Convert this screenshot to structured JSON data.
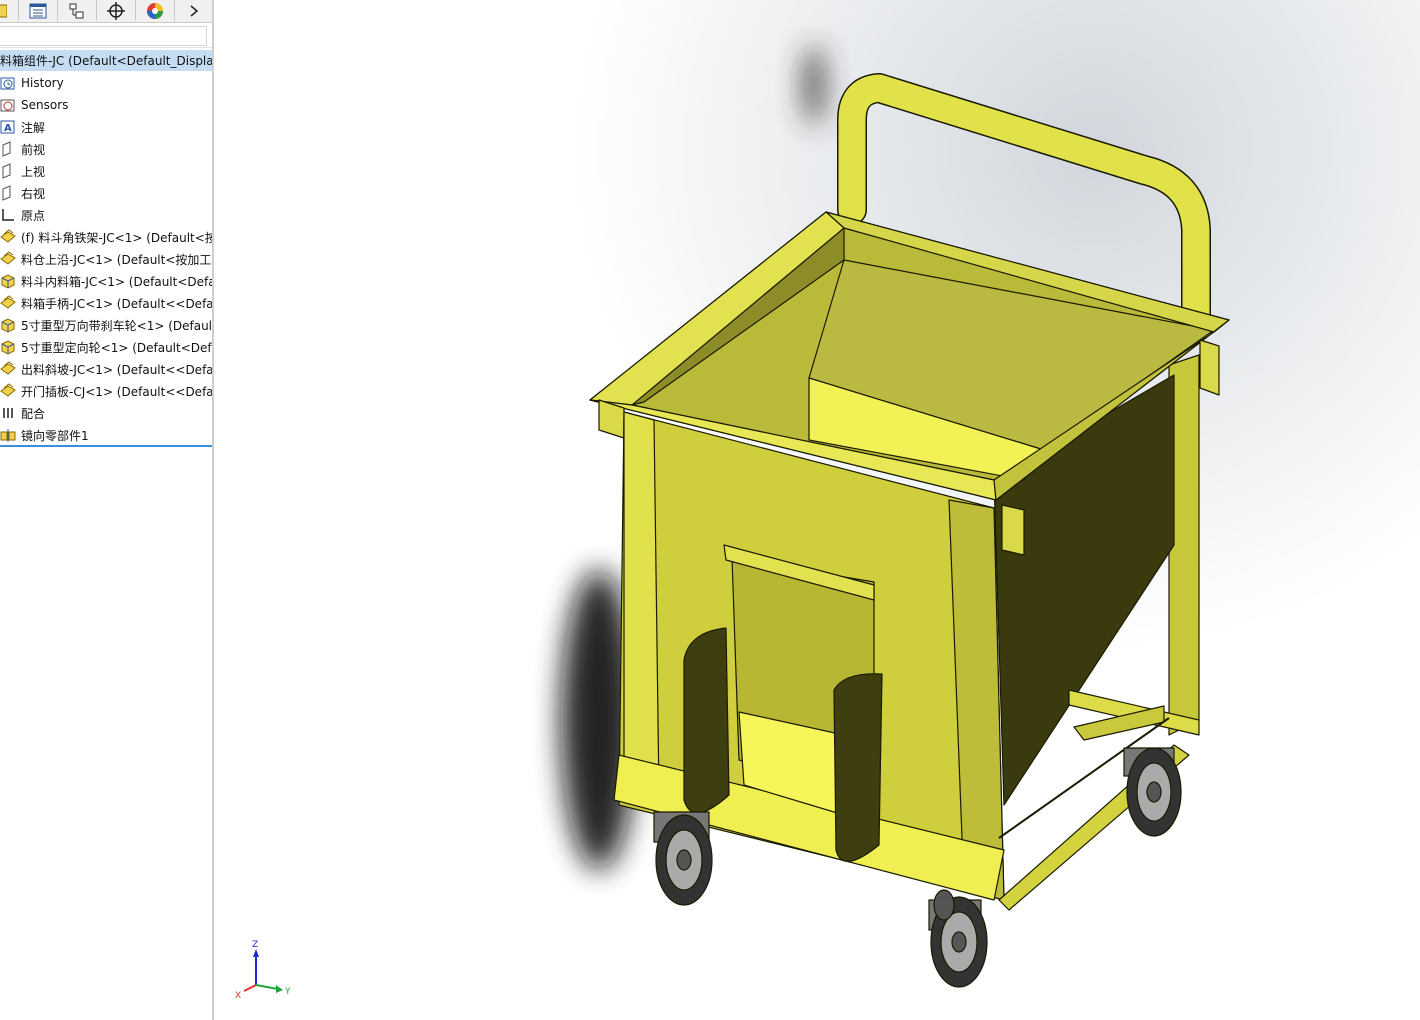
{
  "toolbar": {
    "tabs": [
      {
        "icon": "feature-manager-icon"
      },
      {
        "icon": "property-manager-icon"
      },
      {
        "icon": "configuration-manager-icon"
      },
      {
        "icon": "dimxpert-icon"
      },
      {
        "icon": "display-manager-icon"
      },
      {
        "icon": "chevron-right-icon"
      }
    ]
  },
  "feature_tree": {
    "root": {
      "label": "料箱组件-JC  (Default<Default_Display"
    },
    "items": [
      {
        "label": "History",
        "icon": "history-icon"
      },
      {
        "label": "Sensors",
        "icon": "sensors-icon"
      },
      {
        "label": "注解",
        "icon": "annotations-icon"
      },
      {
        "label": "前视",
        "icon": "plane-icon"
      },
      {
        "label": "上视",
        "icon": "plane-icon"
      },
      {
        "label": "右视",
        "icon": "plane-icon"
      },
      {
        "label": "原点",
        "icon": "origin-icon"
      },
      {
        "label": "(f) 料斗角铁架-JC<1> (Default<按",
        "icon": "subassembly-icon"
      },
      {
        "label": "料仓上沿-JC<1> (Default<按加工>",
        "icon": "subassembly-icon"
      },
      {
        "label": "料斗内料箱-JC<1> (Default<Defa",
        "icon": "part-icon"
      },
      {
        "label": "料箱手柄-JC<1> (Default<<Defau",
        "icon": "subassembly-icon"
      },
      {
        "label": "5寸重型万向带刹车轮<1> (Default",
        "icon": "part-icon"
      },
      {
        "label": "5寸重型定向轮<1> (Default<Defa",
        "icon": "part-icon"
      },
      {
        "label": "出料斜坡-JC<1> (Default<<Defau",
        "icon": "subassembly-icon"
      },
      {
        "label": "开门插板-CJ<1> (Default<<Defau",
        "icon": "subassembly-icon"
      },
      {
        "label": "配合",
        "icon": "mates-icon"
      },
      {
        "label": "镜向零部件1",
        "icon": "mirror-component-icon"
      }
    ]
  },
  "viewport": {
    "model_color": "#eaea3a",
    "triad": {
      "x": "X",
      "y": "Y",
      "z": "Z"
    }
  }
}
